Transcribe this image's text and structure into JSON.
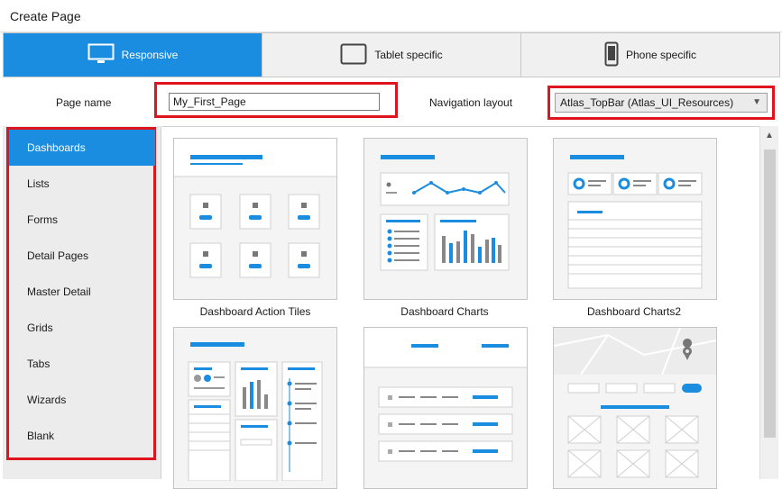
{
  "window": {
    "title": "Create Page"
  },
  "tabs": [
    {
      "label": "Responsive",
      "icon": "monitor-icon",
      "active": true
    },
    {
      "label": "Tablet specific",
      "icon": "tablet-icon",
      "active": false
    },
    {
      "label": "Phone specific",
      "icon": "phone-icon",
      "active": false
    }
  ],
  "form": {
    "page_name_label": "Page name",
    "page_name_value": "My_First_Page",
    "nav_layout_label": "Navigation layout",
    "nav_layout_value": "Atlas_TopBar (Atlas_UI_Resources)"
  },
  "sidebar": {
    "items": [
      {
        "label": "Dashboards",
        "active": true
      },
      {
        "label": "Lists"
      },
      {
        "label": "Forms"
      },
      {
        "label": "Detail Pages"
      },
      {
        "label": "Master Detail"
      },
      {
        "label": "Grids"
      },
      {
        "label": "Tabs"
      },
      {
        "label": "Wizards"
      },
      {
        "label": "Blank"
      }
    ]
  },
  "templates": [
    {
      "label": "Dashboard Action Tiles"
    },
    {
      "label": "Dashboard Charts"
    },
    {
      "label": "Dashboard Charts2"
    },
    {
      "label": ""
    },
    {
      "label": ""
    },
    {
      "label": ""
    }
  ],
  "colors": {
    "accent": "#1a8de0",
    "highlight_border": "#e0141e",
    "sidebar_bg": "#ececec"
  }
}
